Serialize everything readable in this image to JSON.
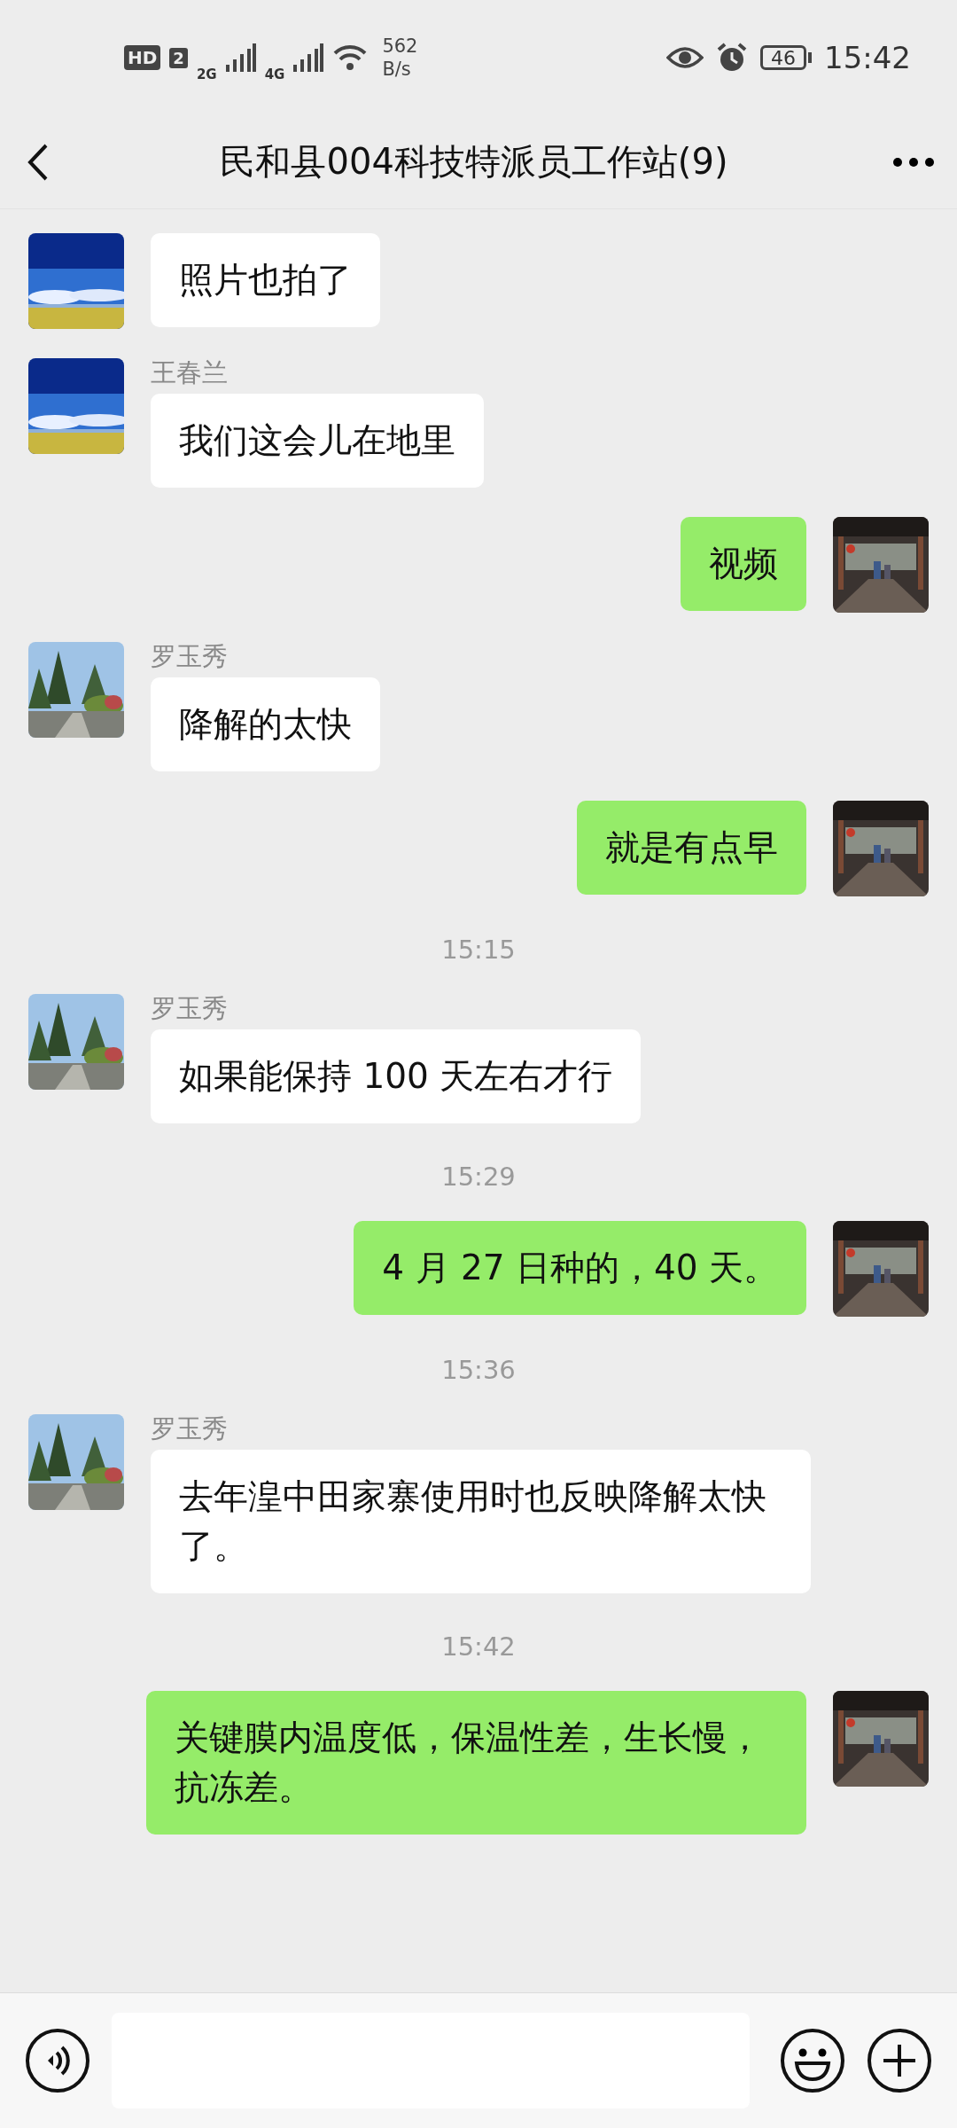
{
  "status_bar": {
    "hd": "HD",
    "sim": "2",
    "net_1": "2G",
    "net_2": "4G",
    "speed_value": "562",
    "speed_unit": "B/s",
    "battery": "46",
    "time": "15:42"
  },
  "header": {
    "title": "民和县004科技特派员工作站(9)"
  },
  "messages": [
    {
      "kind": "received",
      "text": "照片也拍了"
    },
    {
      "kind": "received",
      "sender": "王春兰",
      "text": "我们这会儿在地里"
    },
    {
      "kind": "sent",
      "text": "视频"
    },
    {
      "kind": "received",
      "sender": "罗玉秀",
      "text": "降解的太快"
    },
    {
      "kind": "sent",
      "text": "就是有点早"
    },
    {
      "kind": "time",
      "text": "15:15"
    },
    {
      "kind": "received",
      "sender": "罗玉秀",
      "text": "如果能保持 100 天左右才行"
    },
    {
      "kind": "time",
      "text": "15:29"
    },
    {
      "kind": "sent",
      "text": "4 月 27 日种的，40 天。"
    },
    {
      "kind": "time",
      "text": "15:36"
    },
    {
      "kind": "received",
      "sender": "罗玉秀",
      "text": "去年湟中田家寨使用时也反映降解太快了。"
    },
    {
      "kind": "time",
      "text": "15:42"
    },
    {
      "kind": "sent",
      "text": "关键膜内温度低，保温性差，生长慢，抗冻差。"
    }
  ]
}
